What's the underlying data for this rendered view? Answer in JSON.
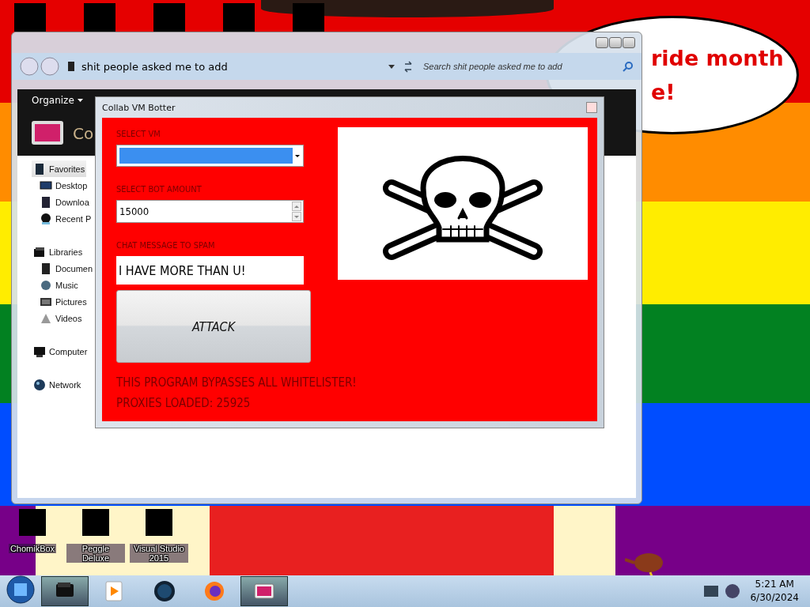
{
  "wallpaper": {
    "banner_lines": [
      "ride month",
      "e!"
    ]
  },
  "desktop_icons": [
    {
      "label": "ChomikBox"
    },
    {
      "label": "Peggle Deluxe"
    },
    {
      "label": "Visual Studio 2015"
    }
  ],
  "explorer": {
    "address": "shit people asked me to add",
    "search": {
      "placeholder": "Search shit people asked me to add"
    },
    "toolbar": [
      {
        "label": "Organize"
      }
    ],
    "header_title": "Co",
    "sidebar": [
      {
        "label": "Favorites",
        "kind": "favorites",
        "selected": true,
        "children": [
          {
            "label": "Desktop",
            "kind": "desktop",
            "selected": false
          },
          {
            "label": "Downloa",
            "kind": "downloads",
            "selected": false
          },
          {
            "label": "Recent P",
            "kind": "recent",
            "selected": false
          }
        ]
      },
      {
        "label": "Libraries",
        "kind": "libraries",
        "selected": false,
        "children": [
          {
            "label": "Documen",
            "kind": "documents",
            "selected": false
          },
          {
            "label": "Music",
            "kind": "music",
            "selected": false
          },
          {
            "label": "Pictures",
            "kind": "pictures",
            "selected": false
          },
          {
            "label": "Videos",
            "kind": "videos",
            "selected": false
          }
        ]
      },
      {
        "label": "Computer",
        "kind": "computer",
        "selected": false
      },
      {
        "label": "Network",
        "kind": "network",
        "selected": false
      }
    ]
  },
  "app": {
    "title": "Collab VM Botter",
    "fields": [
      {
        "kind": "dropdown",
        "label": "SELECT VM"
      },
      {
        "kind": "spinner",
        "label": "SELECT BOT AMOUNT",
        "value": "15000"
      },
      {
        "kind": "text",
        "label": "CHAT MESSAGE TO SPAM",
        "value": "I HAVE MORE THAN U!"
      }
    ],
    "button": "ATTACK",
    "notes": [
      "THIS PROGRAM BYPASSES ALL WHITELISTER!",
      "PROXIES LOADED: 25925"
    ]
  },
  "taskbar": {
    "apps": [
      {
        "kind": "folder",
        "selected": true
      },
      {
        "kind": "media",
        "selected": false
      },
      {
        "kind": "globe",
        "selected": false
      },
      {
        "kind": "firefox",
        "selected": false
      },
      {
        "kind": "app",
        "selected": true
      }
    ],
    "time": "5:21 AM",
    "date": "6/30/2024"
  }
}
